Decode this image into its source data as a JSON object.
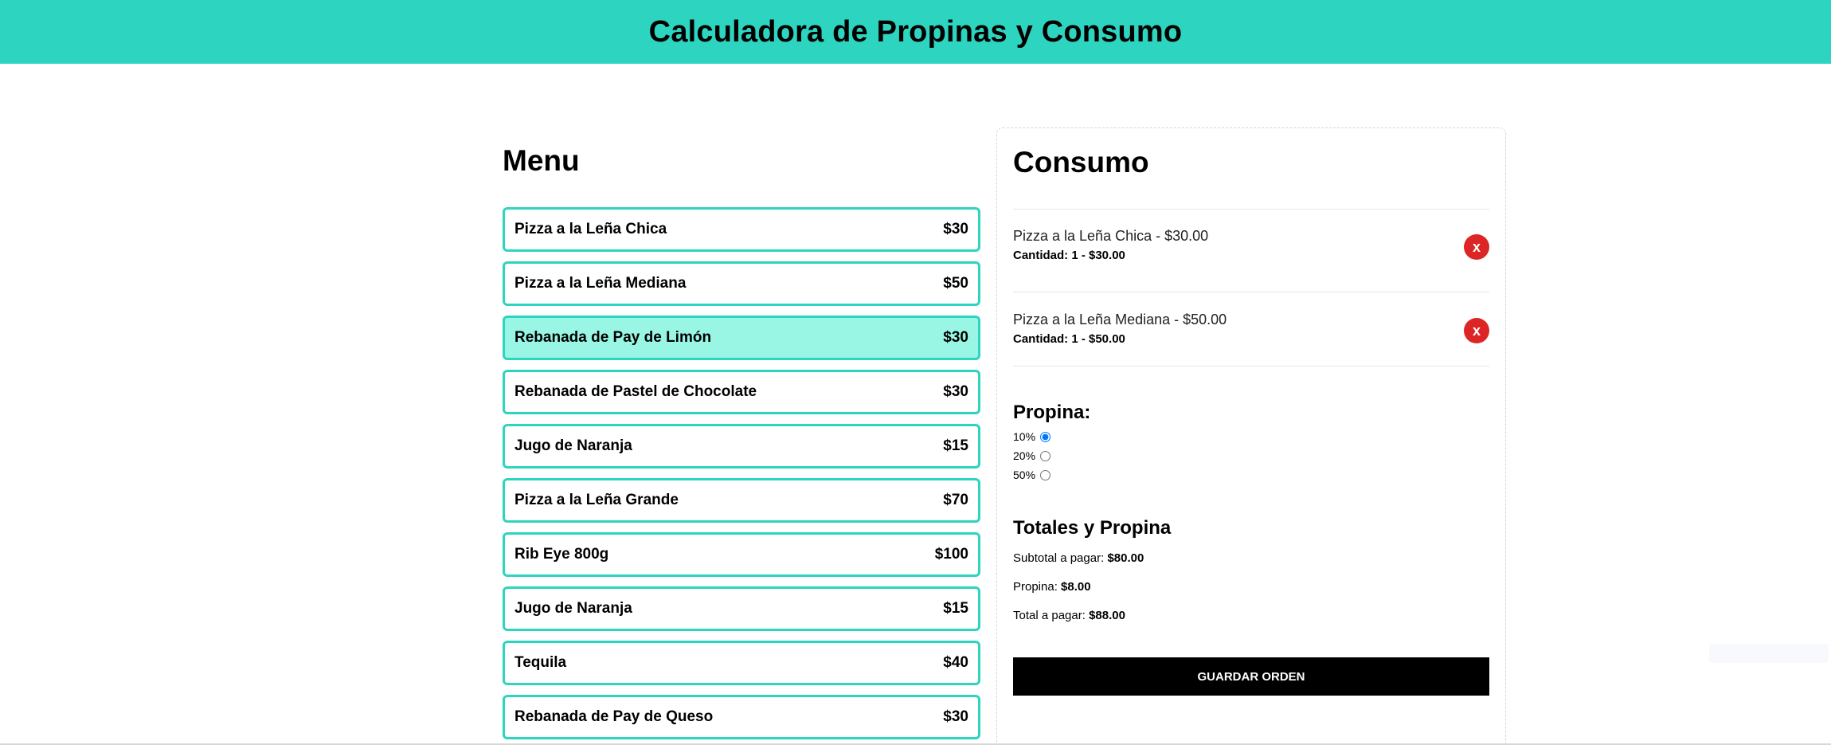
{
  "header": {
    "title": "Calculadora de Propinas y Consumo"
  },
  "menu": {
    "title": "Menu",
    "items": [
      {
        "name": "Pizza a la Leña Chica",
        "price": "$30"
      },
      {
        "name": "Pizza a la Leña Mediana",
        "price": "$50"
      },
      {
        "name": "Rebanada de Pay de Limón",
        "price": "$30"
      },
      {
        "name": "Rebanada de Pastel de Chocolate",
        "price": "$30"
      },
      {
        "name": "Jugo de Naranja",
        "price": "$15"
      },
      {
        "name": "Pizza a la Leña Grande",
        "price": "$70"
      },
      {
        "name": "Rib Eye 800g",
        "price": "$100"
      },
      {
        "name": "Jugo de Naranja",
        "price": "$15"
      },
      {
        "name": "Tequila",
        "price": "$40"
      },
      {
        "name": "Rebanada de Pay de Queso",
        "price": "$30"
      }
    ],
    "highlighted_index": 2
  },
  "consumo": {
    "title": "Consumo",
    "orders": [
      {
        "name": "Pizza a la Leña Chica - $30.00",
        "qty": "Cantidad: 1 - $30.00",
        "remove_label": "x"
      },
      {
        "name": "Pizza a la Leña Mediana - $50.00",
        "qty": "Cantidad: 1 - $50.00",
        "remove_label": "x"
      }
    ],
    "tip": {
      "title": "Propina:",
      "options": [
        {
          "label": "10%",
          "checked": true
        },
        {
          "label": "20%",
          "checked": false
        },
        {
          "label": "50%",
          "checked": false
        }
      ]
    },
    "totals": {
      "title": "Totales y Propina",
      "subtotal_label": "Subtotal a pagar:",
      "subtotal_value": "$80.00",
      "tip_label": "Propina:",
      "tip_value": "$8.00",
      "total_label": "Total a pagar:",
      "total_value": "$88.00"
    },
    "save_label": "GUARDAR ORDEN"
  },
  "colors": {
    "accent": "#2dd4bf",
    "highlight": "#99f6e4",
    "remove": "#dc2626",
    "button": "#000000"
  }
}
